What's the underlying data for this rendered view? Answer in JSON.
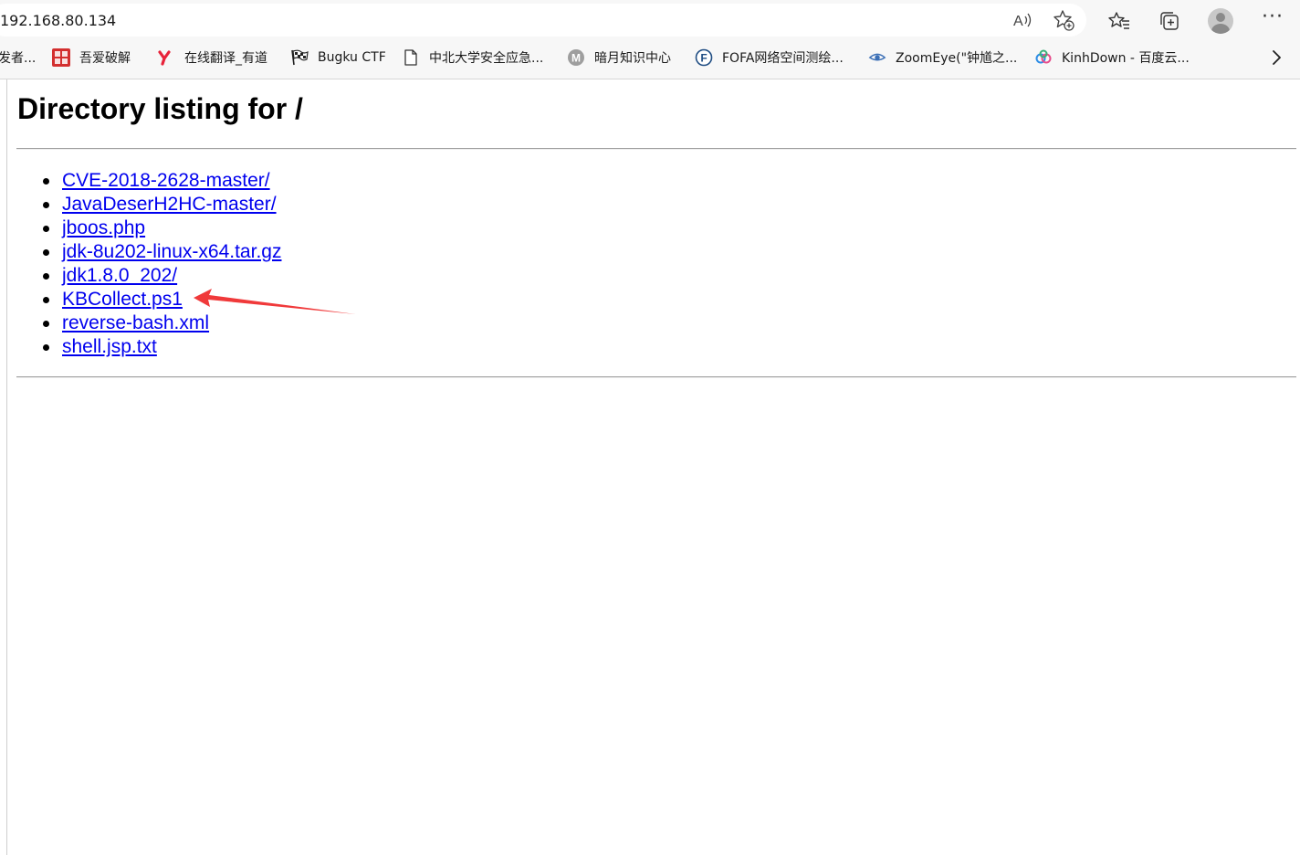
{
  "browser": {
    "url": "192.168.80.134",
    "read_aloud_icon": "read-aloud-icon",
    "add_favorite_icon": "add-favorite-icon",
    "favorites_icon": "favorites-icon",
    "collections_icon": "collections-icon",
    "profile_icon": "profile-avatar-icon",
    "more_icon": "more-options-icon",
    "more_label": "···"
  },
  "favorites": [
    {
      "label": "发者...",
      "icon": "none"
    },
    {
      "label": "吾爱破解",
      "icon": "52pojie-icon",
      "icon_text": "吾爱\n破解",
      "color": "#d32f2f"
    },
    {
      "label": "在线翻译_有道",
      "icon": "youdao-icon",
      "icon_text": "y",
      "color": "#e8233a"
    },
    {
      "label": "Bugku CTF",
      "icon": "checkered-flag-icon"
    },
    {
      "label": "中北大学安全应急...",
      "icon": "page-icon"
    },
    {
      "label": "暗月知识中心",
      "icon": "anyue-icon",
      "icon_text": "M",
      "color": "#9e9e9e"
    },
    {
      "label": "FOFA网络空间测绘...",
      "icon": "fofa-icon",
      "icon_text": "F",
      "color": "#1e4c82"
    },
    {
      "label": "ZoomEye(\"钟馗之...",
      "icon": "zoomeye-icon",
      "color": "#3b6fb6"
    },
    {
      "label": "KinhDown - 百度云...",
      "icon": "kinhdown-icon",
      "color": "#2b8ce6"
    }
  ],
  "favorites_more_icon": "chevron-right-icon",
  "page": {
    "title": "Directory listing for /",
    "files": [
      "CVE-2018-2628-master/",
      "JavaDeserH2HC-master/",
      "jboos.php",
      "jdk-8u202-linux-x64.tar.gz",
      "jdk1.8.0_202/",
      "KBCollect.ps1",
      "reverse-bash.xml",
      "shell.jsp.txt"
    ],
    "link_color": "#0000ee"
  },
  "annotation": {
    "type": "red-arrow",
    "points_to": "KBCollect.ps1",
    "color": "#f0393a"
  }
}
